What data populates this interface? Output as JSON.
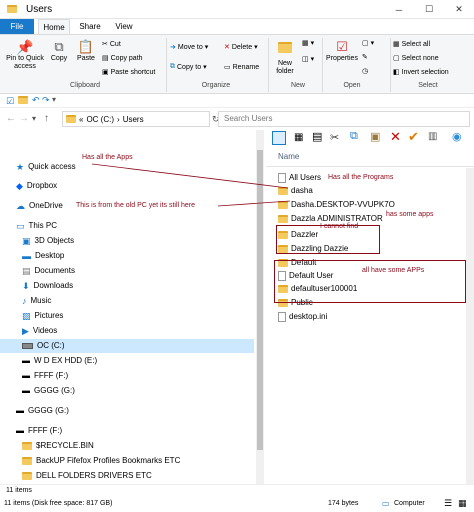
{
  "window": {
    "title": "Users"
  },
  "tabs": [
    {
      "label": "File"
    },
    {
      "label": "Home"
    },
    {
      "label": "Share"
    },
    {
      "label": "View"
    }
  ],
  "ribbon": {
    "clipboard": {
      "label": "Clipboard",
      "pin": "Pin to Quick\naccess",
      "copy": "Copy",
      "paste": "Paste",
      "cut": "Cut",
      "copy_path": "Copy path",
      "paste_shortcut": "Paste shortcut"
    },
    "organize": {
      "label": "Organize",
      "move_to": "Move to",
      "copy_to": "Copy to",
      "delete": "Delete",
      "rename": "Rename"
    },
    "new": {
      "label": "New",
      "new_folder": "New\nfolder"
    },
    "open": {
      "label": "Open",
      "properties": "Properties"
    },
    "select": {
      "label": "Select",
      "select_all": "Select all",
      "select_none": "Select none",
      "invert": "Invert selection"
    }
  },
  "address": {
    "root": "«",
    "seg1": "OC (C:)",
    "sep": "›",
    "seg2": "Users"
  },
  "search": {
    "placeholder": "Search Users"
  },
  "nav": {
    "items": [
      {
        "label": "Quick access"
      },
      {
        "label": "Dropbox"
      },
      {
        "label": "OneDrive"
      },
      {
        "label": "This PC"
      },
      {
        "label": "3D Objects"
      },
      {
        "label": "Desktop"
      },
      {
        "label": "Documents"
      },
      {
        "label": "Downloads"
      },
      {
        "label": "Music"
      },
      {
        "label": "Pictures"
      },
      {
        "label": "Videos"
      },
      {
        "label": "OC  (C:)"
      },
      {
        "label": "W D EX HDD  (E:)"
      },
      {
        "label": "FFFF (F:)"
      },
      {
        "label": "GGGG (G:)"
      },
      {
        "label": "GGGG (G:)"
      },
      {
        "label": "FFFF (F:)"
      },
      {
        "label": "$RECYCLE.BIN"
      },
      {
        "label": "BackUP Fifefox Profiles Bookmarks ETC"
      },
      {
        "label": "DELL FOLDERS DRIVERS ETC"
      }
    ]
  },
  "content": {
    "header": "Name",
    "items": [
      {
        "label": "All Users"
      },
      {
        "label": "dasha"
      },
      {
        "label": "Dasha.DESKTOP-VVUPK7O"
      },
      {
        "label": "Dazzla ADMINISTRATOR"
      },
      {
        "label": "Dazzler"
      },
      {
        "label": "Dazzling Dazzie"
      },
      {
        "label": "Default"
      },
      {
        "label": "Default User"
      },
      {
        "label": "defaultuser100001"
      },
      {
        "label": "Public"
      },
      {
        "label": "desktop.ini"
      }
    ]
  },
  "annotations": {
    "has_all_apps": "Has all the Apps",
    "has_all_programs": "Has all the Programs",
    "old_pc": "This is from the old PC yet its still here",
    "has_some_apps": "has some apps",
    "cannot_find": "I cannot find",
    "all_have_some": "all have some APPs"
  },
  "status": {
    "items_count": "11 items",
    "disk_space": "11 items (Disk free space: 817 GB)",
    "size": "174 bytes",
    "location": "Computer"
  },
  "colors": {
    "accent": "#1979ca",
    "annotation": "#8b0a1a",
    "selection": "#cce8ff"
  }
}
